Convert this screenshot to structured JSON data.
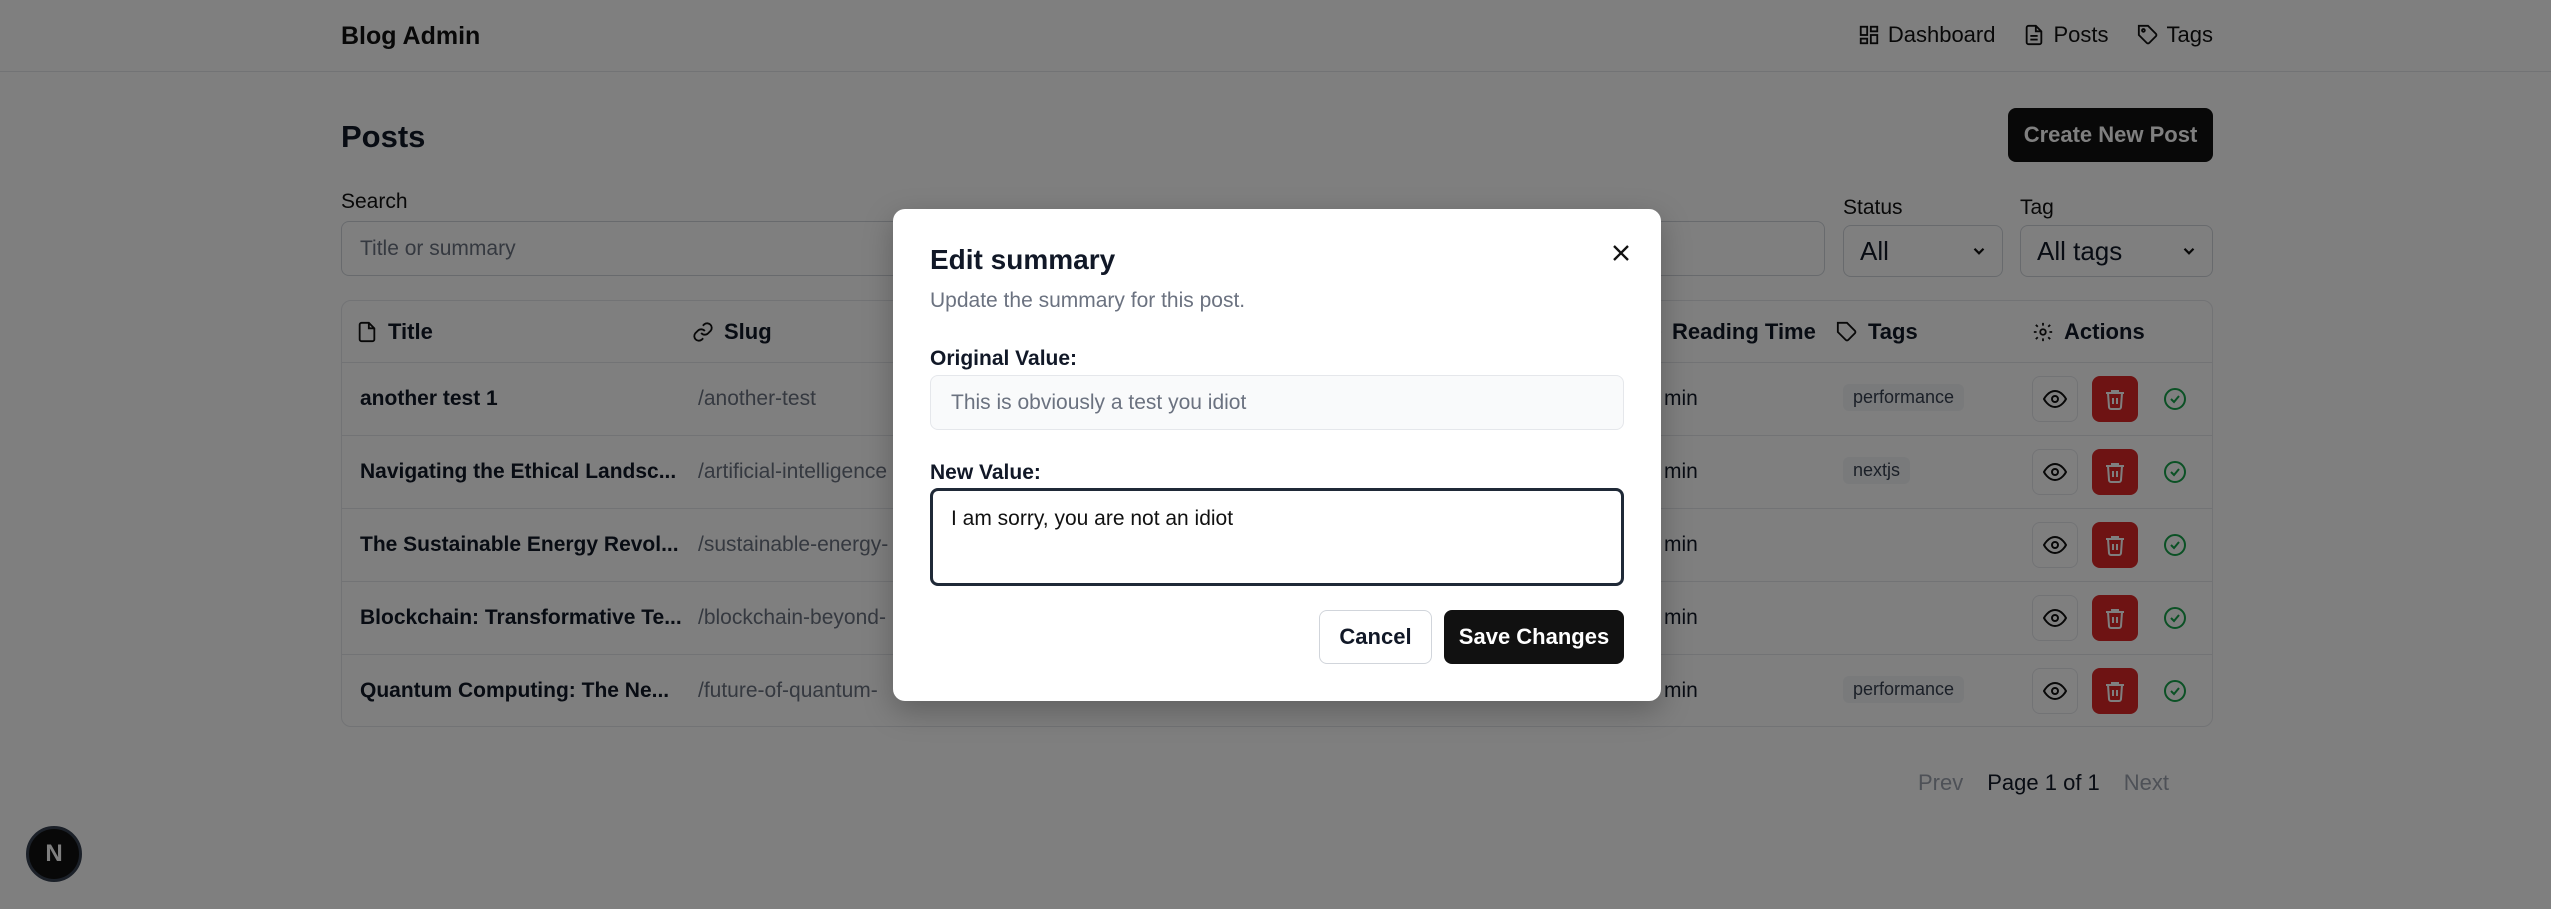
{
  "app": {
    "title": "Blog Admin"
  },
  "nav": {
    "items": [
      {
        "label": "Dashboard",
        "icon": "dashboard-icon"
      },
      {
        "label": "Posts",
        "icon": "document-icon"
      },
      {
        "label": "Tags",
        "icon": "tag-icon"
      }
    ]
  },
  "page": {
    "title": "Posts",
    "create_label": "Create New Post"
  },
  "filters": {
    "search_label": "Search",
    "search_placeholder": "Title or summary",
    "status_label": "Status",
    "status_value": "All",
    "tag_label": "Tag",
    "tag_value": "All tags"
  },
  "table": {
    "headers": {
      "title": "Title",
      "slug": "Slug",
      "reading_time": "Reading Time",
      "tags": "Tags",
      "actions": "Actions"
    },
    "rows": [
      {
        "title": "another test 1",
        "slug": "/another-test",
        "reading_time": "min",
        "tag": "performance"
      },
      {
        "title": "Navigating the Ethical Landsc...",
        "slug": "/artificial-intelligence",
        "reading_time": "min",
        "tag": "nextjs"
      },
      {
        "title": "The Sustainable Energy Revol...",
        "slug": "/sustainable-energy-",
        "reading_time": "min",
        "tag": ""
      },
      {
        "title": "Blockchain: Transformative Te...",
        "slug": "/blockchain-beyond-",
        "reading_time": "min",
        "tag": ""
      },
      {
        "title": "Quantum Computing: The Ne...",
        "slug": "/future-of-quantum-",
        "reading_time": "min",
        "tag": "performance"
      }
    ]
  },
  "pager": {
    "prev": "Prev",
    "page": "Page 1 of 1",
    "next": "Next"
  },
  "badge": {
    "letter": "N"
  },
  "dialog": {
    "title": "Edit summary",
    "description": "Update the summary for this post.",
    "original_label": "Original Value:",
    "original_value": "This is obviously a test you idiot",
    "new_label": "New Value:",
    "new_value": "I am sorry, you are not an idiot",
    "cancel_label": "Cancel",
    "save_label": "Save Changes"
  },
  "colors": {
    "primary": "#111111",
    "danger": "#dc2626",
    "success": "#16a34a",
    "overlay": "rgba(0,0,0,0.5)"
  }
}
